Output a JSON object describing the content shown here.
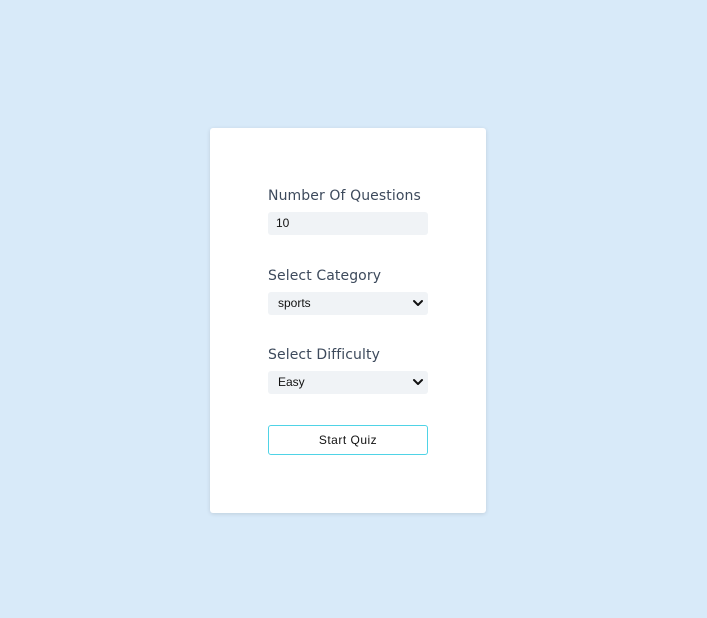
{
  "form": {
    "questions": {
      "label": "Number Of Questions",
      "value": "10"
    },
    "category": {
      "label": "Select Category",
      "selected": "sports"
    },
    "difficulty": {
      "label": "Select Difficulty",
      "selected": "Easy"
    },
    "start_label": "Start Quiz"
  },
  "colors": {
    "page_background": "#d8eaf9",
    "card_background": "#ffffff",
    "field_background": "#f0f3f6",
    "label_text": "#3d4a5c",
    "button_border": "#4fd3e6"
  },
  "icons": {
    "select_arrow": "chevron-down-icon"
  }
}
